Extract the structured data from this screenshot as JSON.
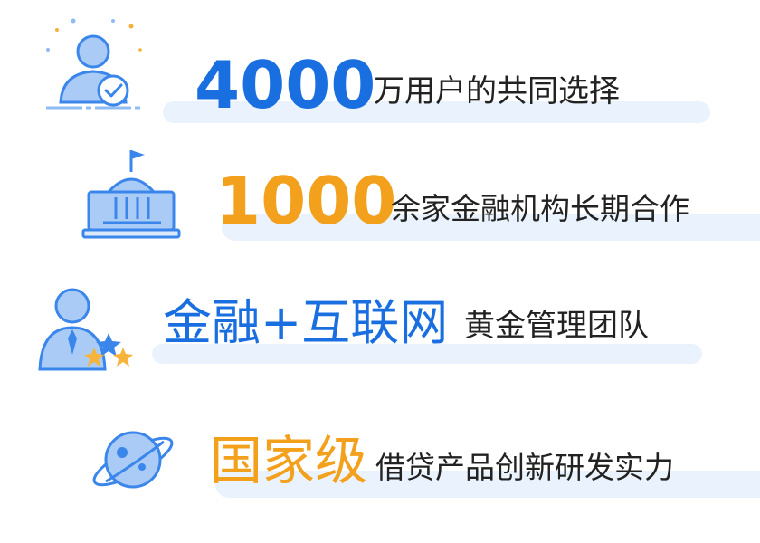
{
  "colors": {
    "blue": "#1a6fe0",
    "orange": "#f3a11d",
    "bar": "#eaf3fd",
    "icon_fill": "#a9cbf5",
    "icon_stroke": "#3b86ea",
    "star": "#f6b53a",
    "text": "#222222"
  },
  "rows": [
    {
      "icon": "user-check-icon",
      "highlight": "4000",
      "highlight_color": "blue",
      "caption": "万用户的共同选择"
    },
    {
      "icon": "institution-building-icon",
      "highlight": "1000",
      "highlight_color": "orange",
      "caption": "余家金融机构长期合作"
    },
    {
      "icon": "team-star-icon",
      "highlight": "金融+互联网",
      "highlight_color": "blue",
      "caption": "黄金管理团队"
    },
    {
      "icon": "planet-icon",
      "highlight": "国家级",
      "highlight_color": "orange",
      "caption": "借贷产品创新研发实力"
    }
  ]
}
